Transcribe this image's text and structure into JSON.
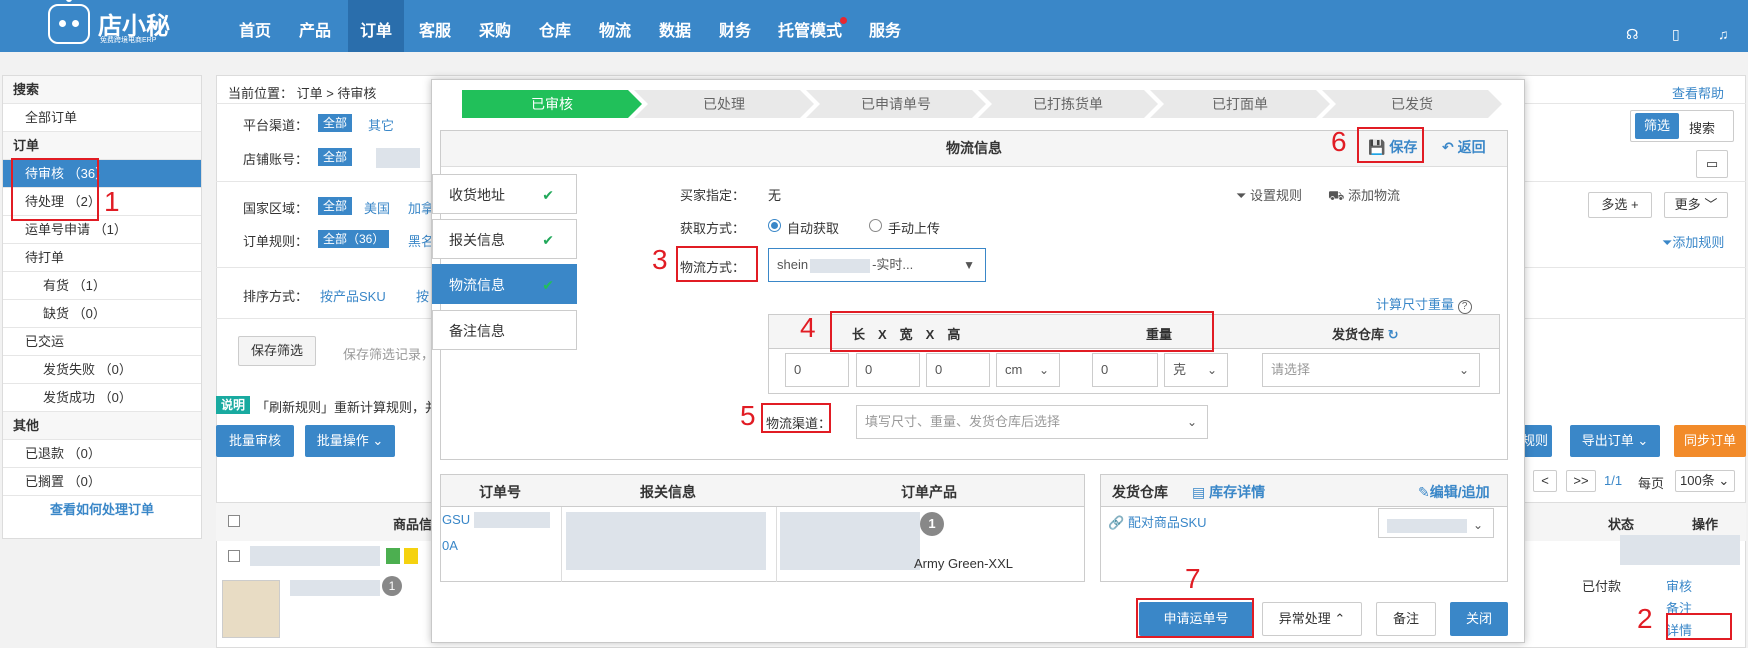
{
  "brand": {
    "name": "店小秘",
    "subtitle": "免费跨境电商ERP"
  },
  "nav": [
    "首页",
    "产品",
    "订单",
    "客服",
    "采购",
    "仓库",
    "物流",
    "数据",
    "财务",
    "托管模式",
    "服务"
  ],
  "sidebar": {
    "search_head": "搜索",
    "all_orders": "全部订单",
    "order_head": "订单",
    "pending_review": "待审核 （36）",
    "pending_process": "待处理 （2）",
    "waybill_apply": "运单号申请 （1）",
    "to_print": "待打单",
    "in_stock": "有货 （1）",
    "out_stock": "缺货 （0）",
    "delivered": "已交运",
    "ship_fail": "发货失败 （0）",
    "ship_ok": "发货成功 （0）",
    "other_head": "其他",
    "refunded": "已退款 （0）",
    "shelved": "已搁置 （0）",
    "howto": "查看如何处理订单"
  },
  "main": {
    "crumb": "当前位置：  订单 > 待审核",
    "help": "查看帮助",
    "platform_label": "平台渠道：",
    "all": "全部",
    "other": "其它",
    "shop_label": "店铺账号：",
    "country_label": "国家区域：",
    "us": "美国",
    "ca": "加拿",
    "rule_label": "订单规则：",
    "all36": "全部（36）",
    "black": "黑名",
    "sort_label": "排序方式：",
    "sort_sku": "按产品SKU",
    "sort_more": "按",
    "save_filter": "保存筛选",
    "save_filter_hint": "保存筛选记录，",
    "filter_btn": "筛选",
    "search_btn": "搜索",
    "multi": "多选 +",
    "more": "更多",
    "add_rule": "添加规则",
    "tip_tag": "说明",
    "tip_text": "「刷新规则」重新计算规则，并",
    "batch_review": "批量审核",
    "batch_ops": "批量操作",
    "rule_btn": "规则",
    "export": "导出订单",
    "sync": "同步订单",
    "pg_prev": "<",
    "pg_next": ">>",
    "pg_count": "1/1",
    "per_page": "每页",
    "per_val": "100条",
    "col_product": "商品信",
    "col_status": "状态",
    "col_action": "操作",
    "paid": "已付款",
    "act_review": "审核",
    "act_note": "备注",
    "act_detail": "详情"
  },
  "modal": {
    "steps": [
      "已审核",
      "已处理",
      "已申请单号",
      "已打拣货单",
      "已打面单",
      "已发货"
    ],
    "section_title": "物流信息",
    "save": "保存",
    "back": "返回",
    "tabs": [
      "收货地址",
      "报关信息",
      "物流信息",
      "备注信息"
    ],
    "buyer_label": "买家指定：",
    "buyer_value": "无",
    "set_rule": "设置规则",
    "add_logistics": "添加物流",
    "fetch_label": "获取方式：",
    "auto": "自动获取",
    "manual": "手动上传",
    "method_label": "物流方式：",
    "method_prefix": "shein",
    "method_suffix": "-实时...",
    "calc_weight": "计算尺寸重量",
    "dim_head": "长　X　宽　X　高",
    "weight_head": "重量",
    "wh_head": "发货仓库",
    "dims": [
      "0",
      "0",
      "0"
    ],
    "unit": "cm",
    "weight": "0",
    "weight_unit": "克",
    "wh_placeholder": "请选择",
    "channel_label": "物流渠道：",
    "channel_placeholder": "填写尺寸、重量、发货仓库后选择",
    "col_order": "订单号",
    "col_customs": "报关信息",
    "col_product": "订单产品",
    "order_no_a": "GSU",
    "order_no_b": "0A",
    "qty": "1",
    "variant": "Army Green-XXL",
    "wh_col": "发货仓库",
    "stock_detail": "库存详情",
    "edit_add": "编辑/追加",
    "match_sku": "配对商品SKU",
    "apply_waybill": "申请运单号",
    "exception": "异常处理",
    "note": "备注",
    "close": "关闭"
  },
  "annotations": [
    "1",
    "2",
    "3",
    "4",
    "5",
    "6",
    "7"
  ]
}
